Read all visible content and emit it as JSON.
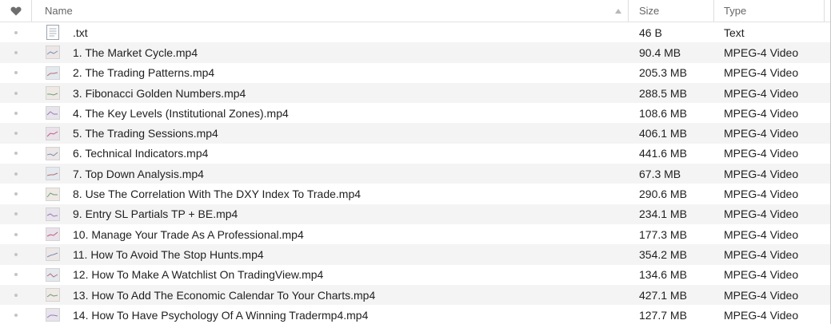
{
  "header": {
    "name_label": "Name",
    "size_label": "Size",
    "type_label": "Type"
  },
  "files": [
    {
      "name": ".txt",
      "size": "46 B",
      "type": "Text",
      "icon": "text-file-icon"
    },
    {
      "name": "1. The Market Cycle.mp4",
      "size": "90.4 MB",
      "type": "MPEG-4 Video",
      "icon": "video-thumbnail-icon"
    },
    {
      "name": "2. The Trading Patterns.mp4",
      "size": "205.3 MB",
      "type": "MPEG-4 Video",
      "icon": "video-thumbnail-icon"
    },
    {
      "name": "3. Fibonacci Golden Numbers.mp4",
      "size": "288.5 MB",
      "type": "MPEG-4 Video",
      "icon": "video-thumbnail-icon"
    },
    {
      "name": "4. The Key Levels (Institutional Zones).mp4",
      "size": "108.6 MB",
      "type": "MPEG-4 Video",
      "icon": "video-thumbnail-icon"
    },
    {
      "name": "5. The Trading Sessions.mp4",
      "size": "406.1 MB",
      "type": "MPEG-4 Video",
      "icon": "video-thumbnail-icon"
    },
    {
      "name": "6. Technical Indicators.mp4",
      "size": "441.6 MB",
      "type": "MPEG-4 Video",
      "icon": "video-thumbnail-icon"
    },
    {
      "name": "7. Top Down Analysis.mp4",
      "size": "67.3 MB",
      "type": "MPEG-4 Video",
      "icon": "video-thumbnail-icon"
    },
    {
      "name": "8. Use The Correlation With The DXY Index To Trade.mp4",
      "size": "290.6 MB",
      "type": "MPEG-4 Video",
      "icon": "video-thumbnail-icon"
    },
    {
      "name": "9. Entry SL Partials TP + BE.mp4",
      "size": "234.1 MB",
      "type": "MPEG-4 Video",
      "icon": "video-thumbnail-icon"
    },
    {
      "name": "10. Manage Your Trade As A Professional.mp4",
      "size": "177.3 MB",
      "type": "MPEG-4 Video",
      "icon": "video-thumbnail-icon"
    },
    {
      "name": "11. How To Avoid The Stop Hunts.mp4",
      "size": "354.2 MB",
      "type": "MPEG-4 Video",
      "icon": "video-thumbnail-icon"
    },
    {
      "name": "12. How To Make A Watchlist On TradingView.mp4",
      "size": "134.6 MB",
      "type": "MPEG-4 Video",
      "icon": "video-thumbnail-icon"
    },
    {
      "name": "13. How To Add The Economic Calendar To Your Charts.mp4",
      "size": "427.1 MB",
      "type": "MPEG-4 Video",
      "icon": "video-thumbnail-icon"
    },
    {
      "name": "14. How To Have Psychology Of A Winning Tradermp4.mp4",
      "size": "127.7 MB",
      "type": "MPEG-4 Video",
      "icon": "video-thumbnail-icon"
    }
  ]
}
